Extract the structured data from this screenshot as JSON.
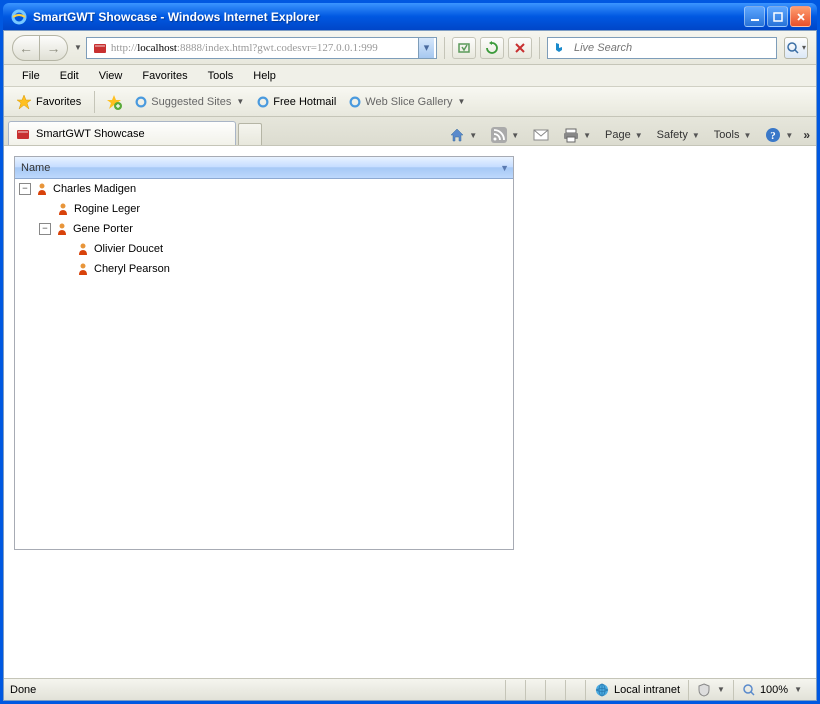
{
  "window": {
    "title": "SmartGWT Showcase - Windows Internet Explorer"
  },
  "nav": {
    "url_prefix": "http://",
    "url_host": "localhost",
    "url_rest": ":8888/index.html?gwt.codesvr=127.0.0.1:999",
    "search_placeholder": "Live Search"
  },
  "menu": {
    "items": [
      "File",
      "Edit",
      "View",
      "Favorites",
      "Tools",
      "Help"
    ]
  },
  "favbar": {
    "favorites_label": "Favorites",
    "suggested": "Suggested Sites",
    "hotmail": "Free Hotmail",
    "webslice": "Web Slice Gallery"
  },
  "tab": {
    "label": "SmartGWT Showcase"
  },
  "tools": {
    "page": "Page",
    "safety": "Safety",
    "tools": "Tools"
  },
  "tree": {
    "header": "Name",
    "nodes": [
      {
        "level": 0,
        "expandable": true,
        "expanded": true,
        "name": "Charles Madigen"
      },
      {
        "level": 1,
        "expandable": false,
        "name": "Rogine Leger"
      },
      {
        "level": 1,
        "expandable": true,
        "expanded": true,
        "name": "Gene Porter"
      },
      {
        "level": 2,
        "expandable": false,
        "name": "Olivier Doucet"
      },
      {
        "level": 2,
        "expandable": false,
        "name": "Cheryl Pearson"
      }
    ]
  },
  "status": {
    "done": "Done",
    "zone": "Local intranet",
    "zoom": "100%"
  }
}
